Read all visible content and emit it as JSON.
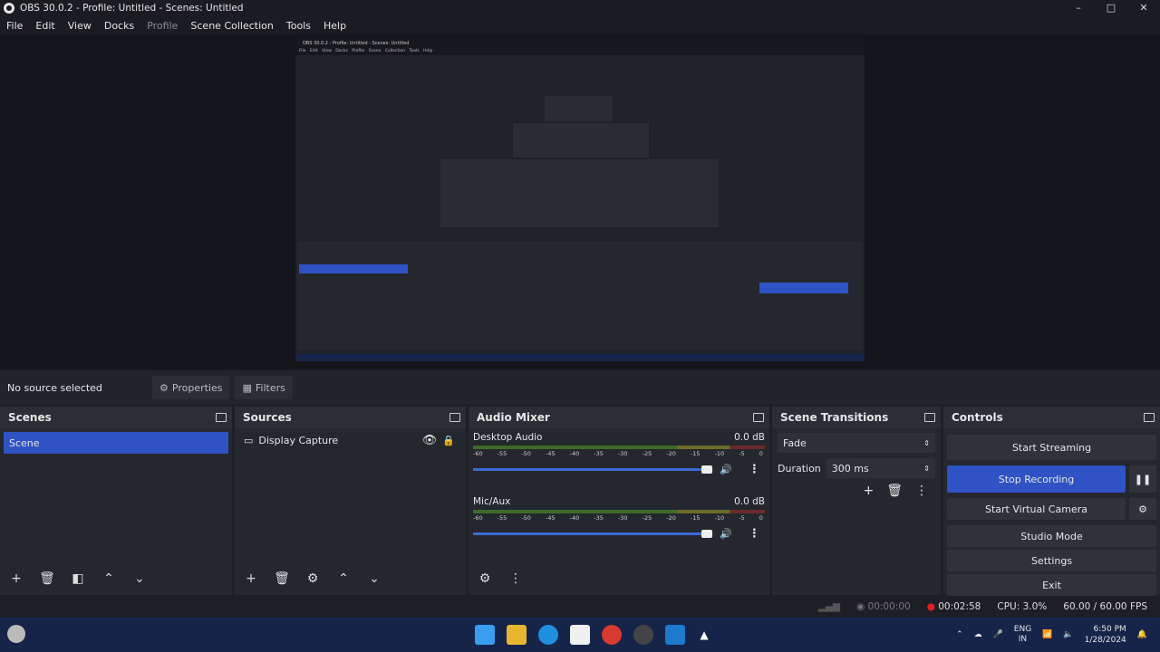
{
  "window": {
    "title": "OBS 30.0.2 - Profile: Untitled - Scenes: Untitled"
  },
  "menu": [
    "File",
    "Edit",
    "View",
    "Docks",
    "Profile",
    "Scene Collection",
    "Tools",
    "Help"
  ],
  "source_bar": {
    "no_source": "No source selected",
    "properties": "Properties",
    "filters": "Filters"
  },
  "scenes": {
    "title": "Scenes",
    "items": [
      "Scene"
    ]
  },
  "sources": {
    "title": "Sources",
    "items": [
      "Display Capture"
    ]
  },
  "audio_mixer": {
    "title": "Audio Mixer",
    "channels": [
      {
        "name": "Desktop Audio",
        "level": "0.0 dB",
        "volume": 1.0
      },
      {
        "name": "Mic/Aux",
        "level": "0.0 dB",
        "volume": 1.0
      }
    ],
    "ticks": [
      "-60",
      "-55",
      "-50",
      "-45",
      "-40",
      "-35",
      "-30",
      "-25",
      "-20",
      "-15",
      "-10",
      "-5",
      "0"
    ]
  },
  "transitions": {
    "title": "Scene Transitions",
    "type": "Fade",
    "duration_label": "Duration",
    "duration": "300 ms"
  },
  "controls": {
    "title": "Controls",
    "start_streaming": "Start Streaming",
    "stop_recording": "Stop Recording",
    "start_virtual_camera": "Start Virtual Camera",
    "studio_mode": "Studio Mode",
    "settings": "Settings",
    "exit": "Exit"
  },
  "status": {
    "stream_time": "00:00:00",
    "rec_time": "00:02:58",
    "cpu": "CPU: 3.0%",
    "fps": "60.00 / 60.00 FPS"
  },
  "taskbar": {
    "lang1": "ENG",
    "lang2": "IN",
    "time": "6:50 PM",
    "date": "1/28/2024"
  },
  "colors": {
    "accent": "#2f52c4",
    "record": "#e02020"
  }
}
